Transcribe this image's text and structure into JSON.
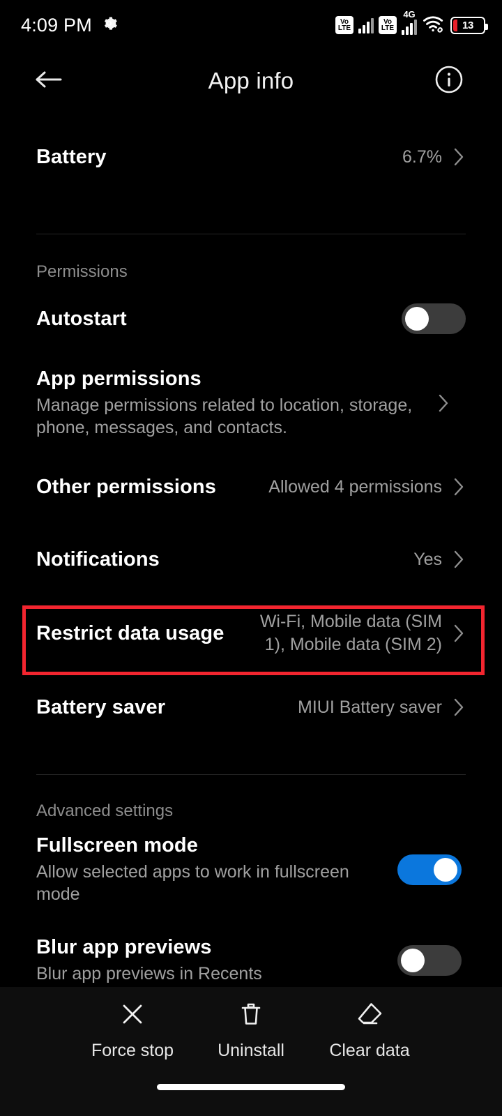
{
  "status_bar": {
    "time": "4:09 PM",
    "gear_icon": "gear-icon",
    "volte_top": "Vo",
    "volte_bottom": "LTE",
    "network_label": "4G",
    "wifi_icon": "wifi-icon",
    "battery_percent": "13"
  },
  "header": {
    "title": "App info",
    "back_icon": "back-arrow-icon",
    "info_icon": "info-icon"
  },
  "battery_row": {
    "title": "Battery",
    "value": "6.7%"
  },
  "permissions_section": {
    "label": "Permissions",
    "autostart": {
      "title": "Autostart",
      "toggle_state": "off"
    },
    "app_permissions": {
      "title": "App permissions",
      "subtitle": "Manage permissions related to location, storage, phone, messages, and contacts."
    },
    "other_permissions": {
      "title": "Other permissions",
      "value": "Allowed 4 permissions"
    },
    "notifications": {
      "title": "Notifications",
      "value": "Yes"
    },
    "restrict_data_usage": {
      "title": "Restrict data usage",
      "value": "Wi-Fi, Mobile data (SIM 1), Mobile data (SIM 2)",
      "highlighted": true,
      "highlight_color": "#f2252f"
    },
    "battery_saver": {
      "title": "Battery saver",
      "value": "MIUI Battery saver"
    }
  },
  "advanced_section": {
    "label": "Advanced settings",
    "fullscreen_mode": {
      "title": "Fullscreen mode",
      "subtitle": "Allow selected apps to work in fullscreen mode",
      "toggle_state": "on"
    },
    "blur_app_previews": {
      "title": "Blur app previews",
      "subtitle": "Blur app previews in Recents",
      "toggle_state": "off"
    }
  },
  "bottom_bar": {
    "actions": [
      {
        "label": "Force stop",
        "icon": "close-x-icon"
      },
      {
        "label": "Uninstall",
        "icon": "trash-icon"
      },
      {
        "label": "Clear data",
        "icon": "eraser-icon"
      }
    ]
  },
  "colors": {
    "background": "#000000",
    "accent_blue": "#0b77dd",
    "highlight_red": "#f2252f",
    "secondary_text": "#a0a0a0"
  }
}
